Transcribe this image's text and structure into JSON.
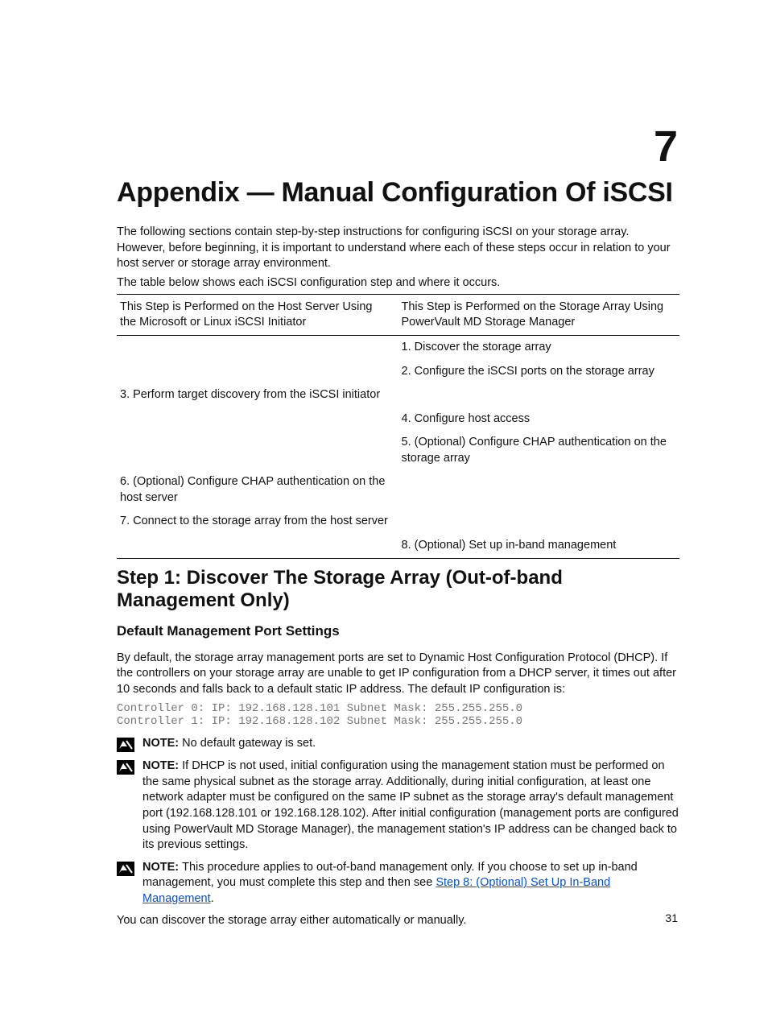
{
  "chapter_number": "7",
  "title": "Appendix — Manual Configuration Of iSCSI",
  "intro_1": "The following sections contain step-by-step instructions for configuring iSCSI on your storage array. However, before beginning, it is important to understand where each of these steps occur in relation to your host server or storage array environment.",
  "intro_2": "The table below shows each iSCSI configuration step and where it occurs.",
  "table": {
    "col1_header": "This Step is Performed on the Host Server Using the Microsoft or Linux iSCSI Initiator",
    "col2_header": "This Step is Performed on the Storage Array Using PowerVault MD Storage Manager",
    "rows": [
      {
        "c1": "",
        "c2": "1. Discover the storage array"
      },
      {
        "c1": "",
        "c2": "2. Configure the iSCSI ports on the storage array"
      },
      {
        "c1": "3. Perform target discovery from the iSCSI initiator",
        "c2": ""
      },
      {
        "c1": "",
        "c2": "4. Configure host access"
      },
      {
        "c1": "",
        "c2": "5. (Optional) Configure CHAP authentication on the storage array"
      },
      {
        "c1": "6. (Optional) Configure CHAP authentication on the host server",
        "c2": ""
      },
      {
        "c1": "7. Connect to the storage array from the host server",
        "c2": ""
      },
      {
        "c1": "",
        "c2": "8. (Optional) Set up in-band management"
      }
    ]
  },
  "step1_heading": "Step 1: Discover The Storage Array (Out-of-band Management Only)",
  "h3_1": "Default Management Port Settings",
  "para_1": "By default, the storage array management ports are set to Dynamic Host Configuration Protocol (DHCP). If the controllers on your storage array are unable to get IP configuration from a DHCP server, it times out after 10 seconds and falls back to a default static IP address. The default IP configuration is:",
  "code_block": "Controller 0: IP: 192.168.128.101 Subnet Mask: 255.255.255.0\nController 1: IP: 192.168.128.102 Subnet Mask: 255.255.255.0",
  "note_label": "NOTE: ",
  "note_1": "No default gateway is set.",
  "note_2": "If DHCP is not used, initial configuration using the management station must be performed on the same physical subnet as the storage array. Additionally, during initial configuration, at least one network adapter must be configured on the same IP subnet as the storage array's default management port (192.168.128.101 or 192.168.128.102). After initial configuration (management ports are configured using PowerVault MD Storage Manager), the management station's IP address can be changed back to its previous settings.",
  "note_3_before": "This procedure applies to out-of-band management only. If you choose to set up in-band management, you must complete this step and then see ",
  "note_3_link": "Step 8: (Optional) Set Up In-Band Management",
  "note_3_after": ".",
  "closing": "You can discover the storage array either automatically or manually.",
  "page_number": "31"
}
